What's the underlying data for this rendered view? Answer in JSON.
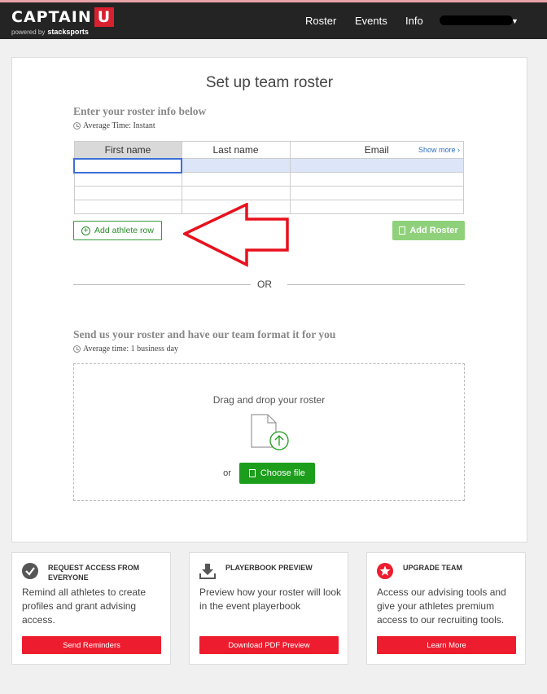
{
  "nav": {
    "logo_text": "CAPTAIN",
    "logo_u": "U",
    "powered_by": "powered by",
    "powered_brand": "stacksports",
    "links": [
      "Roster",
      "Events",
      "Info"
    ]
  },
  "main": {
    "title": "Set up team roster",
    "manual": {
      "heading": "Enter your roster info below",
      "time": "Average Time: Instant",
      "columns": [
        "First name",
        "Last name",
        "Email"
      ],
      "show_more": "Show more",
      "add_row_label": "Add athlete row",
      "add_roster_label": "Add Roster"
    },
    "separator": "OR",
    "upload": {
      "heading": "Send us your roster and have our team format it for you",
      "time": "Average time: 1 business day",
      "drop_label": "Drag and drop your roster",
      "or_label": "or",
      "choose_label": "Choose file"
    }
  },
  "cards": [
    {
      "icon": "check-circle-icon",
      "title": "REQUEST ACCESS FROM EVERYONE",
      "desc": "Remind all athletes to create profiles and grant advising access.",
      "button": "Send Reminders"
    },
    {
      "icon": "download-icon",
      "title": "PLAYERBOOK PREVIEW",
      "desc": "Preview how your roster will look in the event playerbook",
      "button": "Download PDF Preview"
    },
    {
      "icon": "star-icon",
      "title": "UPGRADE TEAM",
      "desc": "Access our advising tools and give your athletes premium access to our recruiting tools.",
      "button": "Learn More"
    }
  ],
  "colors": {
    "brand_red": "#ed1c2e",
    "green": "#1c9e1c",
    "light_green": "#8fd17b",
    "annotation_red": "#e8111d"
  }
}
